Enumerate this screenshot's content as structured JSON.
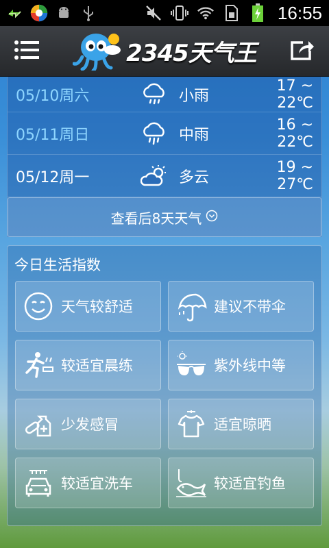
{
  "status_bar": {
    "time": "16:55",
    "icons": [
      "sync-icon",
      "360-app-icon",
      "android-icon",
      "usb-icon",
      "mute-icon",
      "vibrate-icon",
      "wifi-icon",
      "sim-icon",
      "battery-charging-icon"
    ]
  },
  "header": {
    "logo_text": "2345天气王",
    "menu_icon": "menu-icon",
    "share_icon": "share-icon"
  },
  "forecast": [
    {
      "date": "05/10周六",
      "icon": "light-rain-icon",
      "desc": "小雨",
      "temp": "17 ~ 22℃"
    },
    {
      "date": "05/11周日",
      "icon": "moderate-rain-icon",
      "desc": "中雨",
      "temp": "16 ~ 22℃"
    },
    {
      "date": "05/12周一",
      "icon": "partly-cloudy-icon",
      "desc": "多云",
      "temp": "19 ~ 27℃"
    }
  ],
  "more_button": "查看后8天天气",
  "life_index": {
    "title": "今日生活指数",
    "items": [
      {
        "label": "天气较舒适",
        "icon": "smiley-icon"
      },
      {
        "label": "建议不带伞",
        "icon": "umbrella-icon"
      },
      {
        "label": "较适宜晨练",
        "icon": "running-icon"
      },
      {
        "label": "紫外线中等",
        "icon": "sunglasses-icon"
      },
      {
        "label": "少发感冒",
        "icon": "medicine-icon"
      },
      {
        "label": "适宜晾晒",
        "icon": "tshirt-icon"
      },
      {
        "label": "较适宜洗车",
        "icon": "car-wash-icon"
      },
      {
        "label": "较适宜钓鱼",
        "icon": "fishing-icon"
      }
    ]
  },
  "colors": {
    "status_bar_bg": "#000000",
    "header_bg": "#2f3236",
    "date_highlight": "#8fd6ff",
    "text": "#ffffff"
  }
}
